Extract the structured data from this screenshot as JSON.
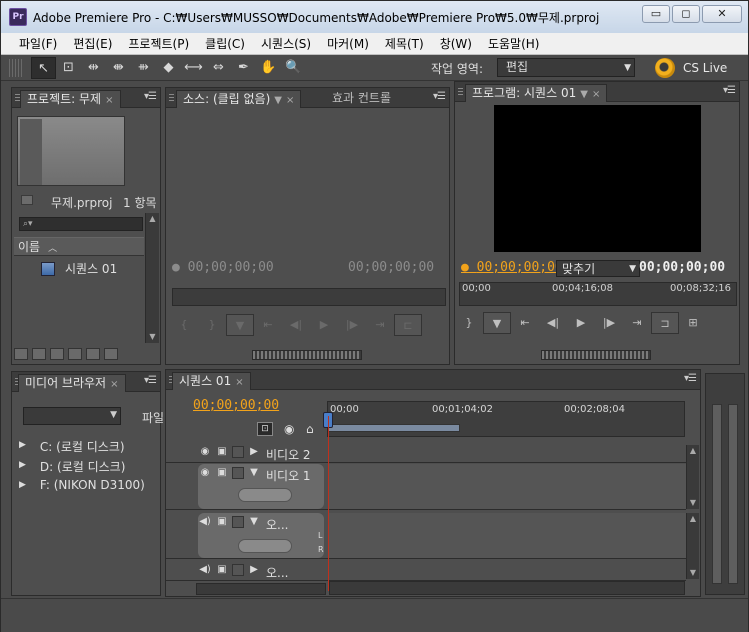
{
  "window": {
    "app_icon": "Pr",
    "title": "Adobe Premiere Pro - C:₩Users₩MUSSO₩Documents₩Adobe₩Premiere Pro₩5.0₩무제.prproj",
    "minimize": "▭",
    "maximize": "◻",
    "close": "✕"
  },
  "menu": [
    "파일(F)",
    "편집(E)",
    "프로젝트(P)",
    "클립(C)",
    "시퀀스(S)",
    "마커(M)",
    "제목(T)",
    "창(W)",
    "도움말(H)"
  ],
  "tools": [
    {
      "name": "selection-tool-icon",
      "glyph": "↖"
    },
    {
      "name": "track-select-tool-icon",
      "glyph": "⊡"
    },
    {
      "name": "ripple-edit-tool-icon",
      "glyph": "⇹"
    },
    {
      "name": "rolling-edit-tool-icon",
      "glyph": "⇼"
    },
    {
      "name": "rate-stretch-tool-icon",
      "glyph": "⇻"
    },
    {
      "name": "razor-tool-icon",
      "glyph": "◆"
    },
    {
      "name": "slip-tool-icon",
      "glyph": "⟷"
    },
    {
      "name": "slide-tool-icon",
      "glyph": "⇔"
    },
    {
      "name": "pen-tool-icon",
      "glyph": "✒"
    },
    {
      "name": "hand-tool-icon",
      "glyph": "✋"
    },
    {
      "name": "zoom-tool-icon",
      "glyph": "🔍"
    }
  ],
  "workspace": {
    "label": "작업 영역:",
    "value": "편집"
  },
  "cslive": {
    "label": "CS Live"
  },
  "project_panel": {
    "tab": "프로젝트: 무제",
    "file_name": "무제.prproj",
    "item_count": "1 항목",
    "column_name": "이름",
    "items": [
      {
        "name": "시퀀스 01"
      }
    ]
  },
  "source_panel": {
    "tab_source": "소스: (클립 없음)",
    "tab_effects": "효과 컨트롤",
    "tc_in": "00;00;00;00",
    "tc_duration": "00;00;00;00"
  },
  "program_panel": {
    "tab": "프로그램: 시퀀스 01",
    "tc_current": "00;00;00;00",
    "fit": "맞추기",
    "tc_duration": "00;00;00;00",
    "ruler_ticks": [
      "00;00",
      "00;04;16;08",
      "00;08;32;16"
    ]
  },
  "media_browser": {
    "tab": "미디어 브라우저",
    "file_label": "파일",
    "drives": [
      "C: (로컬 디스크)",
      "D: (로컬 디스크)",
      "F: (NIKON D3100)"
    ]
  },
  "timeline": {
    "tab": "시퀀스 01",
    "tc": "00;00;00;00",
    "ruler_ticks": [
      "00;00",
      "00;01;04;02",
      "00;02;08;04"
    ],
    "tracks": [
      {
        "name": "비디오 2",
        "type": "video",
        "expanded": false
      },
      {
        "name": "비디오 1",
        "type": "video",
        "expanded": true
      },
      {
        "name": "오...",
        "type": "audio",
        "expanded": true
      },
      {
        "name": "오...",
        "type": "audio",
        "expanded": false
      }
    ],
    "audio_channels": [
      "L",
      "R"
    ]
  }
}
